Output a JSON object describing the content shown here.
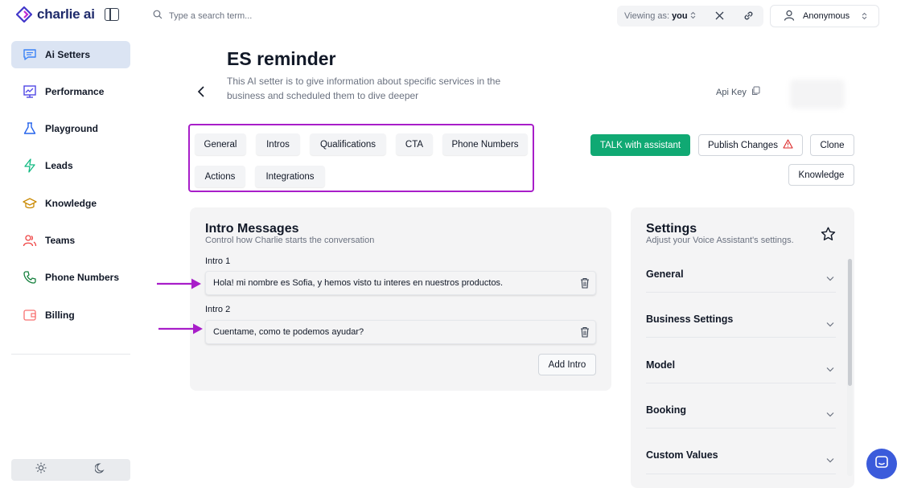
{
  "app": {
    "logo_text": "charlie ai"
  },
  "sidebar": {
    "items": [
      {
        "label": "Ai Setters",
        "icon": "chat-icon",
        "active": true
      },
      {
        "label": "Performance",
        "icon": "chart-icon",
        "active": false
      },
      {
        "label": "Playground",
        "icon": "flask-icon",
        "active": false
      },
      {
        "label": "Leads",
        "icon": "bolt-icon",
        "active": false
      },
      {
        "label": "Knowledge",
        "icon": "graduation-cap-icon",
        "active": false
      },
      {
        "label": "Teams",
        "icon": "users-icon",
        "active": false
      },
      {
        "label": "Phone Numbers",
        "icon": "phone-icon",
        "active": false
      },
      {
        "label": "Billing",
        "icon": "wallet-icon",
        "active": false
      }
    ]
  },
  "topbar": {
    "search_placeholder": "Type a search term...",
    "viewing_prefix": "Viewing as:",
    "viewing_value": "you",
    "user_name": "Anonymous"
  },
  "header": {
    "title": "ES reminder",
    "description": "This AI setter is to give information about specific services in the business and scheduled them to dive deeper",
    "api_key_label": "Api Key"
  },
  "tabs": [
    "General",
    "Intros",
    "Qualifications",
    "CTA",
    "Phone Numbers",
    "Actions",
    "Integrations"
  ],
  "actions": {
    "talk": "TALK with assistant",
    "publish": "Publish Changes",
    "clone": "Clone",
    "knowledge": "Knowledge"
  },
  "intro_card": {
    "title": "Intro Messages",
    "subtitle": "Control how Charlie starts the conversation",
    "intros": [
      {
        "label": "Intro 1",
        "value": "Hola! mi nombre es Sofia, y hemos visto tu interes en nuestros productos."
      },
      {
        "label": "Intro 2",
        "value": "Cuentame, como te podemos ayudar?"
      }
    ],
    "add_button": "Add Intro"
  },
  "settings": {
    "title": "Settings",
    "subtitle": "Adjust your Voice Assistant's settings.",
    "sections": [
      "General",
      "Business Settings",
      "Model",
      "Booking",
      "Custom Values"
    ]
  },
  "colors": {
    "accent_green": "#10a973",
    "annotation_purple": "#a81ec9",
    "active_nav": "#dbe4f3",
    "chat_bubble": "#3b5bdb"
  }
}
